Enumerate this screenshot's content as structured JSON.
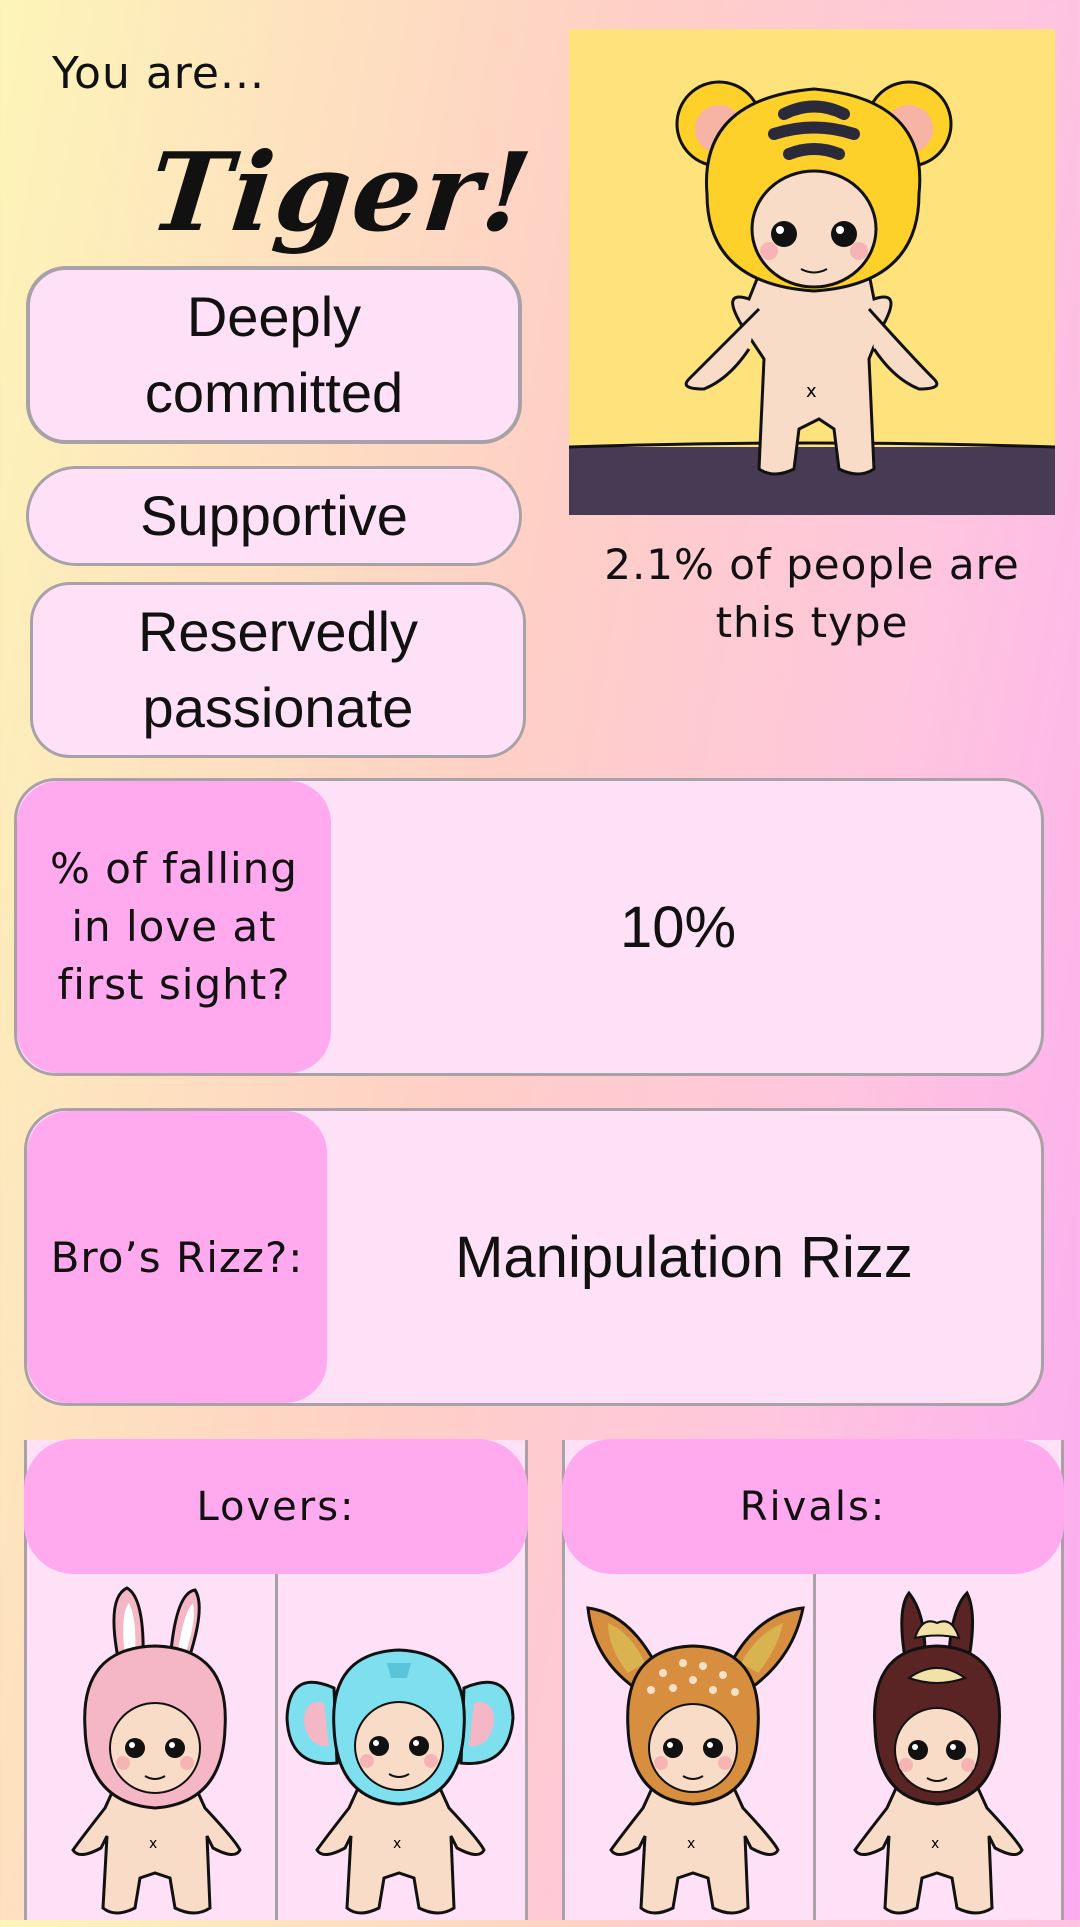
{
  "header": {
    "intro": "You are...",
    "type_name": "Tiger!"
  },
  "traits": [
    "Deeply\ncommitted",
    "Supportive",
    "Reservedly\npassionate"
  ],
  "portrait": {
    "icon": "tiger-hood-doll-icon",
    "background": "#fee37c",
    "floor": "#473a55"
  },
  "stats": {
    "percent_text": "2.1% of people are this type"
  },
  "love_first_sight": {
    "label": "% of falling in love at first sight?",
    "value": "10%"
  },
  "rizz": {
    "label": "Bro’s Rizz?:",
    "value": "Manipulation Rizz"
  },
  "lovers": {
    "label": "Lovers:",
    "items": [
      "bunny-hood-doll-icon",
      "elephant-hood-doll-icon"
    ]
  },
  "rivals": {
    "label": "Rivals:",
    "items": [
      "deer-hood-doll-icon",
      "horse-hood-doll-icon"
    ]
  },
  "colors": {
    "pill_bg": "#ffe1f7",
    "accent_pink": "#ffaaef",
    "border": "#a8a2a8"
  }
}
